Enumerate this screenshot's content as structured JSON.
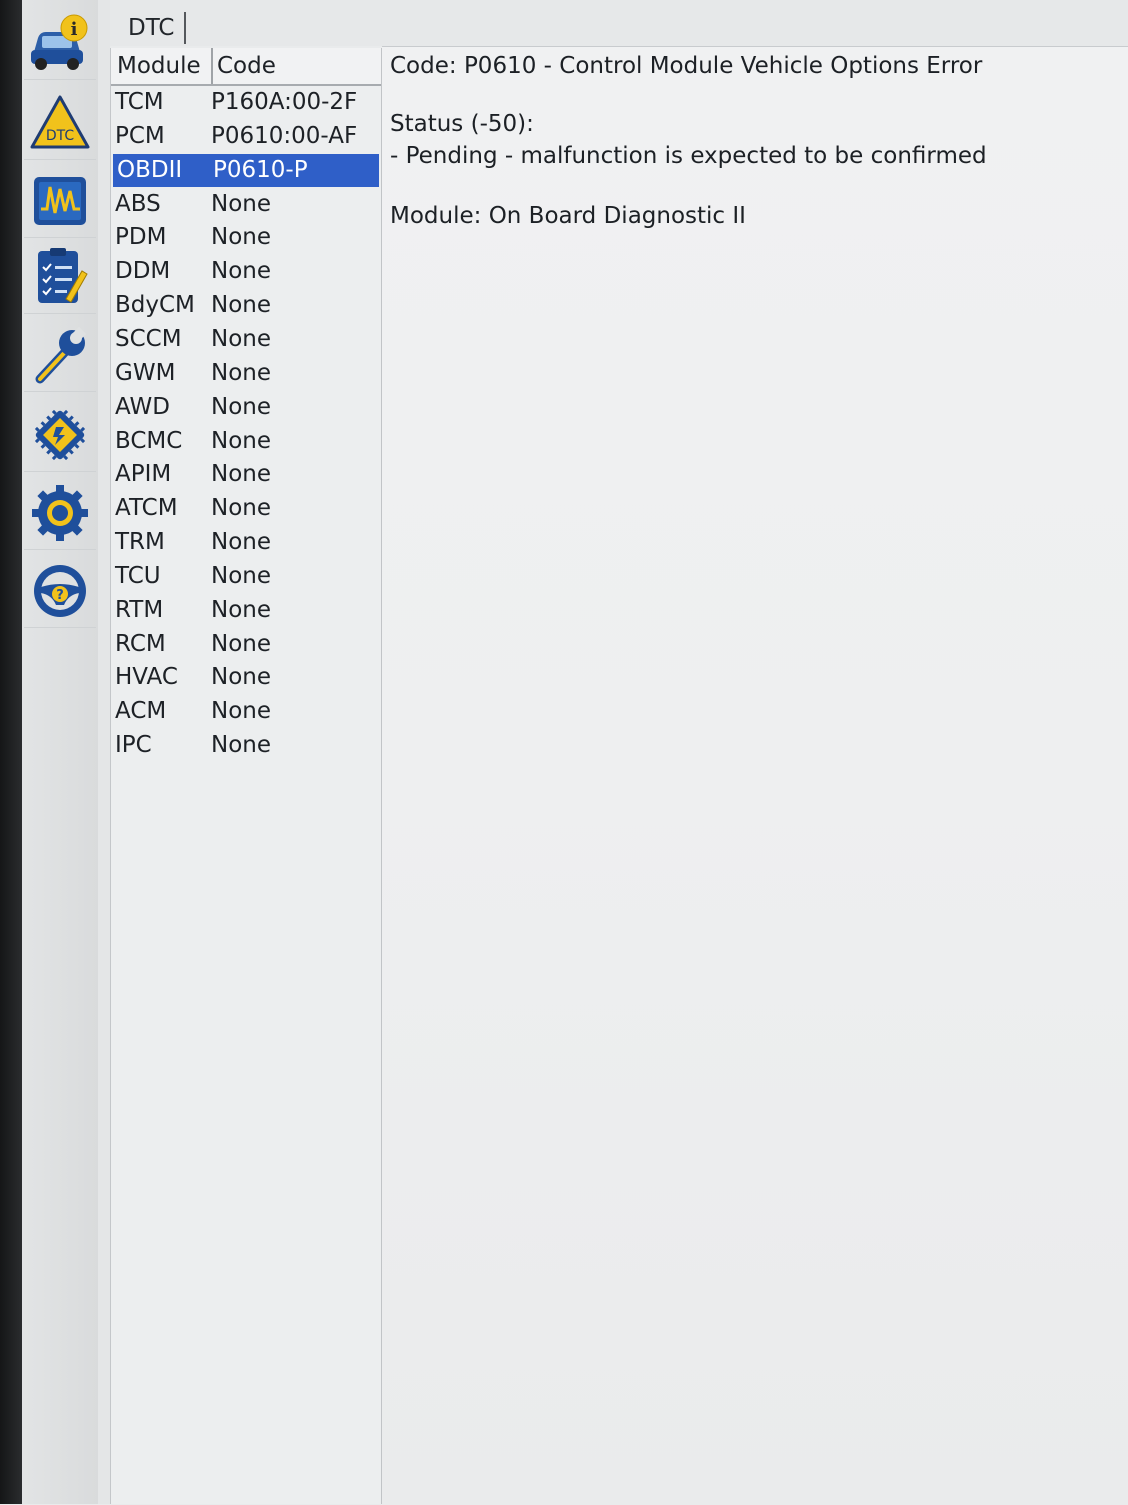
{
  "tabs": [
    {
      "label": "DTC"
    }
  ],
  "sidebar": {
    "icons": [
      {
        "name": "vehicle-info-icon"
      },
      {
        "name": "dtc-warning-icon",
        "label": "DTC"
      },
      {
        "name": "waveform-icon"
      },
      {
        "name": "checklist-icon"
      },
      {
        "name": "wrench-icon"
      },
      {
        "name": "chip-icon"
      },
      {
        "name": "gear-icon"
      },
      {
        "name": "help-wheel-icon",
        "label": "?"
      }
    ]
  },
  "table": {
    "headers": {
      "module": "Module",
      "code": "Code"
    },
    "rows": [
      {
        "module": "TCM",
        "code": "P160A:00-2F"
      },
      {
        "module": "PCM",
        "code": "P0610:00-AF"
      },
      {
        "module": "OBDII",
        "code": "P0610-P",
        "selected": true
      },
      {
        "module": "ABS",
        "code": "None"
      },
      {
        "module": "PDM",
        "code": "None"
      },
      {
        "module": "DDM",
        "code": "None"
      },
      {
        "module": "BdyCM",
        "code": "None"
      },
      {
        "module": "SCCM",
        "code": "None"
      },
      {
        "module": "GWM",
        "code": "None"
      },
      {
        "module": "AWD",
        "code": "None"
      },
      {
        "module": "BCMC",
        "code": "None"
      },
      {
        "module": "APIM",
        "code": "None"
      },
      {
        "module": "ATCM",
        "code": "None"
      },
      {
        "module": "TRM",
        "code": "None"
      },
      {
        "module": "TCU",
        "code": "None"
      },
      {
        "module": "RTM",
        "code": "None"
      },
      {
        "module": "RCM",
        "code": "None"
      },
      {
        "module": "HVAC",
        "code": "None"
      },
      {
        "module": "ACM",
        "code": "None"
      },
      {
        "module": "IPC",
        "code": "None"
      }
    ]
  },
  "detail": {
    "code_line": "Code: P0610 - Control Module Vehicle Options Error",
    "status_line": "Status (-50):",
    "status_detail": " - Pending - malfunction is expected to be confirmed",
    "module_line": "Module: On Board Diagnostic II"
  },
  "colors": {
    "selection": "#2f5fc8",
    "accent_yellow": "#f1c21b",
    "icon_blue": "#1f4f9b"
  }
}
